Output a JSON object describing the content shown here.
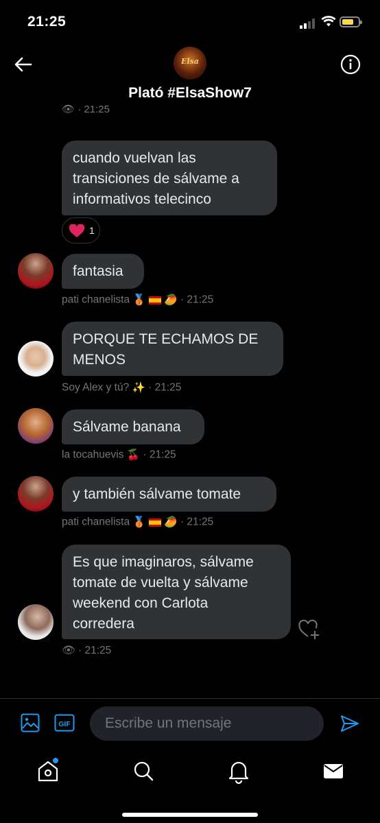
{
  "status_bar": {
    "time": "21:25"
  },
  "header": {
    "title": "Plató #ElsaShow7",
    "avatar_text": "Elsa"
  },
  "colors": {
    "accent": "#1d9bf0",
    "bubble": "#2f3336",
    "muted": "#71767b",
    "heart": "#f91880"
  },
  "messages": [
    {
      "partial_meta": "· 21:25"
    },
    {
      "text_lines": [
        "cuando vuelvan las",
        "transiciones de sálvame a",
        "informativos telecinco"
      ],
      "reaction": {
        "icon": "heart-icon",
        "count": "1"
      }
    },
    {
      "text": "fantasia",
      "sender": "pati chanelista",
      "time": "· 21:25"
    },
    {
      "text_lines": [
        "PORQUE TE ECHAMOS DE",
        "MENOS"
      ],
      "sender": "Soy Alex y tú?",
      "time": "· 21:25"
    },
    {
      "text": "Sálvame banana",
      "sender": "la tocahuevis",
      "time": "· 21:25"
    },
    {
      "text": "y también sálvame tomate",
      "sender": "pati chanelista",
      "time": "· 21:25"
    },
    {
      "text_lines": [
        "Es que imaginaros, sálvame",
        "tomate de vuelta y sálvame",
        "weekend con Carlota",
        "corredera"
      ],
      "time": "· 21:25"
    }
  ],
  "composer": {
    "placeholder": "Escribe un mensaje"
  },
  "tabs": [
    "home-icon",
    "search-icon",
    "notifications-icon",
    "messages-icon"
  ]
}
